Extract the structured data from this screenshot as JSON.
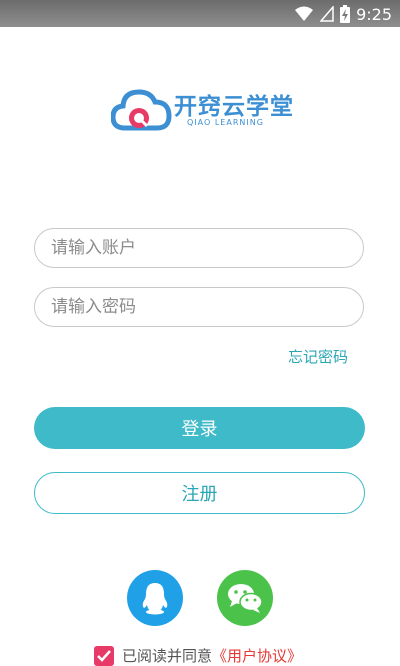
{
  "status_bar": {
    "time": "9:25",
    "icons": [
      "wifi-icon",
      "signal-icon",
      "battery-charging-icon"
    ]
  },
  "logo": {
    "title": "开窍云学堂",
    "subtitle": "QIAO LEARNING"
  },
  "form": {
    "account_placeholder": "请输入账户",
    "password_placeholder": "请输入密码",
    "forgot_password": "忘记密码"
  },
  "buttons": {
    "login": "登录",
    "register": "注册"
  },
  "social": {
    "icons": [
      "qq-icon",
      "wechat-icon"
    ]
  },
  "agreement": {
    "checked": true,
    "text": "已阅读并同意",
    "link": "《用户协议》"
  },
  "colors": {
    "accent": "#3ebac8",
    "logo_blue": "#3c8fd3",
    "qq": "#20a0e6",
    "wechat": "#4bc24a",
    "checkbox": "#e83a66",
    "link": "#e53935"
  }
}
